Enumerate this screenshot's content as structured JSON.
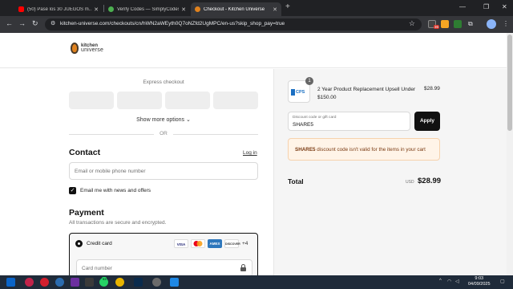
{
  "browser": {
    "tabs": [
      {
        "title": "(50) Pasé los 30 JUEGOS m...",
        "favicon_color": "#ff0000"
      },
      {
        "title": "Verify Codes — SimplyCodes",
        "favicon_color": "#4caf50"
      },
      {
        "title": "Checkout - Kitchen Universe",
        "favicon_color": "#e0821e",
        "active": true
      }
    ],
    "url": "kitchen-universe.com/checkouts/cn/hWN2aWEyth0Q7oNZfd2UgMPC/en-us?skip_shop_pay=true",
    "extension_badge": "36"
  },
  "shop": {
    "logo_line1": "kitchen",
    "logo_line2": "universe",
    "express_checkout": "Express checkout",
    "show_more": "Show more options",
    "or": "OR",
    "contact_heading": "Contact",
    "login_link": "Log in",
    "email_placeholder": "Email or mobile phone number",
    "email_offers_label": "Email me with news and offers",
    "payment_heading": "Payment",
    "payment_sub": "All transactions are secure and encrypted.",
    "credit_card_label": "Credit card",
    "card_logos": [
      "VISA",
      "MC",
      "AMEX",
      "DISCOVER"
    ],
    "more_cards": "+4",
    "card_number_placeholder": "Card number"
  },
  "summary": {
    "item_qty": "1",
    "item_thumb_text": "CPS",
    "item_title": "2 Year Product Replacement Upsell Under $150.00",
    "item_price": "$28.99",
    "discount_label": "Discount code or gift card",
    "discount_value": "SHARE5",
    "apply_label": "Apply",
    "alert_code": "SHARE5",
    "alert_text": " discount code isn't valid for the items in your cart",
    "total_label": "Total",
    "total_currency": "USD",
    "total_value": "$28.99"
  },
  "taskbar": {
    "whatsapp_badge": "93",
    "time": "9:03",
    "date": "04/09/2025"
  }
}
